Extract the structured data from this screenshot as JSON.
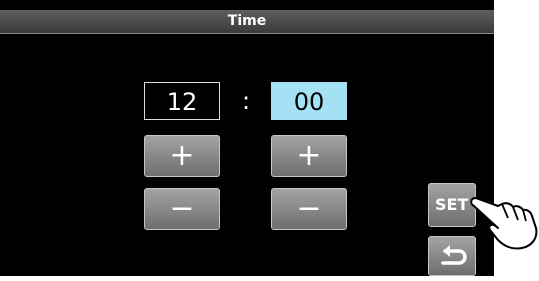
{
  "title": "Time",
  "time": {
    "hour": "12",
    "separator": ":",
    "minute": "00"
  },
  "buttons": {
    "plus": "+",
    "minus": "−",
    "set": "SET"
  },
  "icons": {
    "back": "return-arrow-icon",
    "pointer": "pointing-hand-icon"
  },
  "colors": {
    "minute_highlight": "#a4e1f4",
    "button_gray": "#8c8c8c",
    "background": "#000000"
  }
}
